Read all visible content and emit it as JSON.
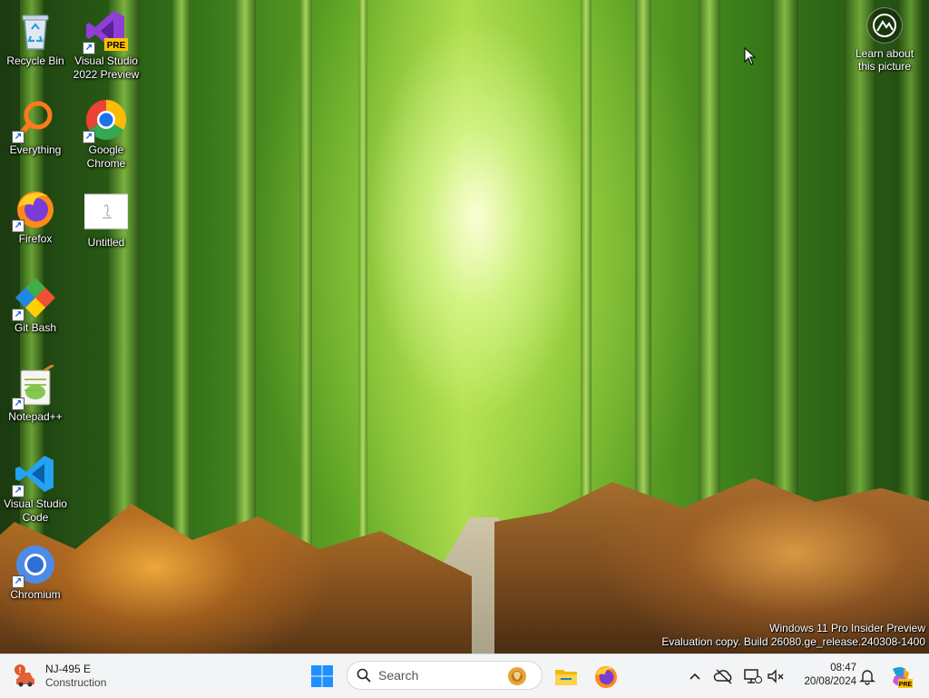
{
  "desktop": {
    "icons_left": [
      {
        "label": "Recycle Bin",
        "icon": "recycle-bin-icon"
      },
      {
        "label": "Everything",
        "icon": "everything-search-icon"
      },
      {
        "label": "Firefox",
        "icon": "firefox-icon"
      },
      {
        "label": "Git Bash",
        "icon": "git-bash-icon"
      },
      {
        "label": "Notepad++",
        "icon": "notepad-plus-plus-icon"
      },
      {
        "label": "Visual Studio Code",
        "icon": "vscode-icon"
      },
      {
        "label": "Chromium",
        "icon": "chromium-icon"
      }
    ],
    "icons_second": [
      {
        "label": "Visual Studio 2022 Preview",
        "icon": "visual-studio-preview-icon",
        "badge": "PRE"
      },
      {
        "label": "Google Chrome",
        "icon": "chrome-icon"
      },
      {
        "label": "Untitled",
        "icon": "document-thumbnail-icon"
      }
    ],
    "learn_picture": {
      "label": "Learn about this picture",
      "icon": "camera-info-icon"
    },
    "watermark": {
      "line1": "Windows 11 Pro Insider Preview",
      "line2": "Evaluation copy. Build 26080.ge_release.240308-1400"
    }
  },
  "taskbar": {
    "weather": {
      "title": "NJ-495 E",
      "subtitle": "Construction",
      "icon": "traffic-alert-icon"
    },
    "search": {
      "placeholder": "Search"
    },
    "apps": [
      {
        "name": "file-explorer-icon"
      },
      {
        "name": "firefox-icon"
      }
    ],
    "tray": {
      "time": "08:47",
      "date": "20/08/2024",
      "icons": [
        "chevron-up-icon",
        "onedrive-offline-icon",
        "network-icon",
        "volume-muted-icon",
        "notification-bell-icon",
        "copilot-icon"
      ]
    }
  },
  "colors": {
    "taskbar_bg": "#f2f4f6",
    "windows_blue": "#1e90ff",
    "vscode_blue": "#23a3f1",
    "vs_purple": "#8f3fd6"
  }
}
